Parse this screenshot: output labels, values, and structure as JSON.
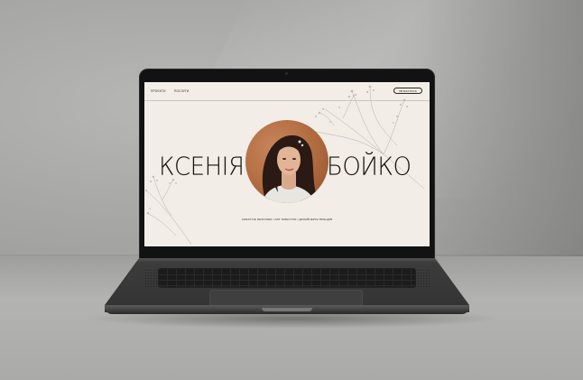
{
  "site": {
    "nav": {
      "projects": "ПРОЄКТИ",
      "services": "ПОСЛУГИ",
      "contact_button": "ЗВ'ЯЗАТИСЬ"
    },
    "hero": {
      "first_name": "КСЕНІЯ",
      "last_name": "БОЙКО",
      "tagline": "CREATIVE DESIGNER | ART DIRECTOR | ДИЗАЙНЕРКА БРЕНДІВ"
    }
  },
  "colors": {
    "page_background": "#f2ede7",
    "text_dark": "#151110",
    "portrait_background": "#b06a3f",
    "laptop_body": "#121212",
    "wall": "#a9a9a7"
  },
  "icons": [
    "botanical-sprig-icon"
  ]
}
